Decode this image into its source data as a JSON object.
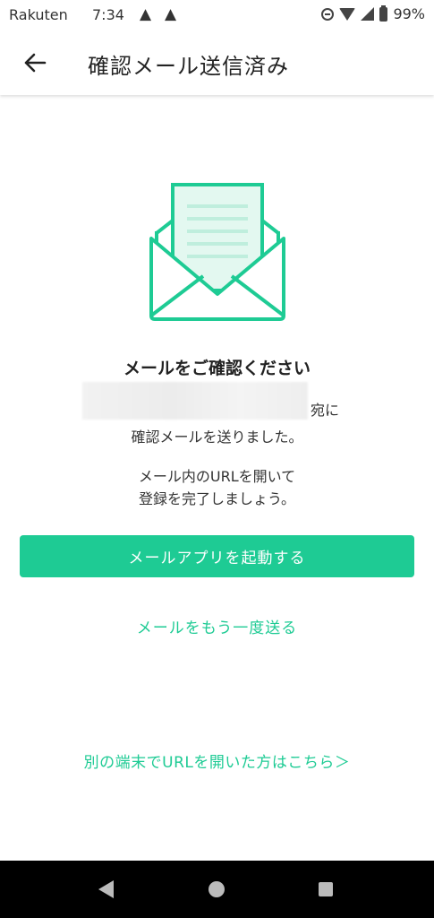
{
  "status_bar": {
    "carrier": "Rakuten",
    "time": "7:34",
    "battery": "99%"
  },
  "app_bar": {
    "title": "確認メール送信済み",
    "back_icon": "arrow-left-icon"
  },
  "colors": {
    "accent": "#1ecb94",
    "envelope_line": "#1ecb94",
    "envelope_fill": "#e3f8f0"
  },
  "content": {
    "heading": "メールをご確認ください",
    "address_suffix": "宛に",
    "sent_line": "確認メールを送りました。",
    "instruction_line1": "メール内のURLを開いて",
    "instruction_line2": "登録を完了しましょう。"
  },
  "actions": {
    "open_mail_app": "メールアプリを起動する",
    "resend": "メールをもう一度送る",
    "other_device": "別の端末でURLを開いた方はこちら＞"
  }
}
